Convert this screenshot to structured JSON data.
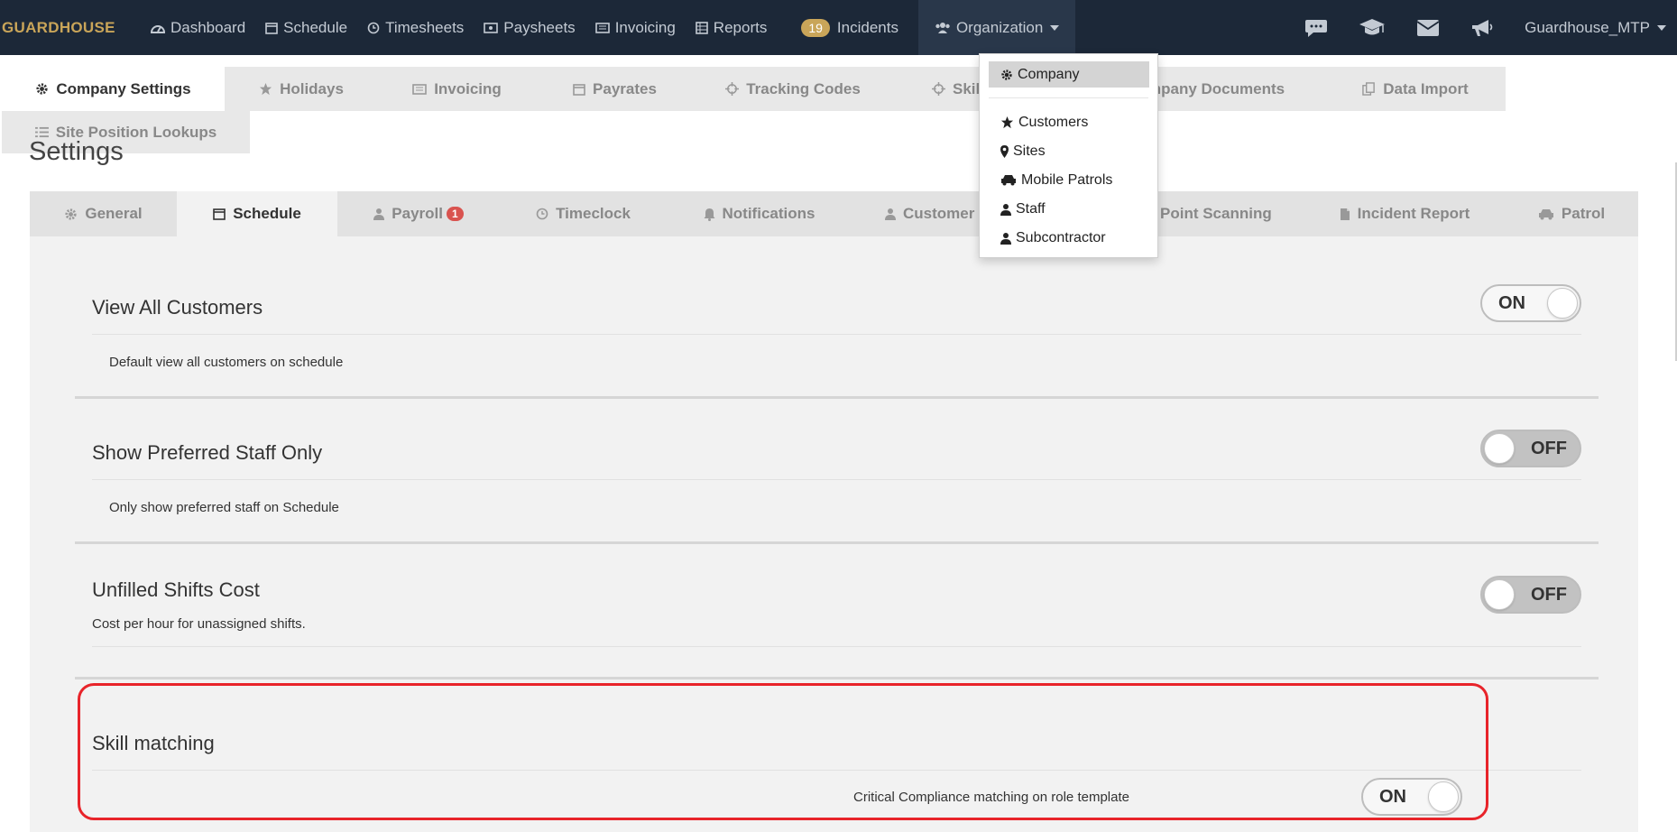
{
  "navbar": {
    "brand": "GUARDHOUSE",
    "items": [
      {
        "label": "Dashboard",
        "icon": "dashboard-icon"
      },
      {
        "label": "Schedule",
        "icon": "calendar-icon"
      },
      {
        "label": "Timesheets",
        "icon": "clock-icon"
      },
      {
        "label": "Paysheets",
        "icon": "money-icon"
      },
      {
        "label": "Invoicing",
        "icon": "invoice-icon"
      },
      {
        "label": "Reports",
        "icon": "table-icon"
      }
    ],
    "incidents": {
      "count": "19",
      "label": "Incidents"
    },
    "organization_label": "Organization",
    "user": "Guardhouse_MTP",
    "right_icons": [
      "chat-icon",
      "graduation-cap-icon",
      "envelope-icon",
      "bullhorn-icon"
    ]
  },
  "org_dropdown": {
    "items": [
      {
        "label": "Company",
        "icon": "gear-icon",
        "active": true
      },
      {
        "label": "Customers",
        "icon": "star-icon"
      },
      {
        "label": "Sites",
        "icon": "map-marker-icon"
      },
      {
        "label": "Mobile Patrols",
        "icon": "car-icon"
      },
      {
        "label": "Staff",
        "icon": "user-icon"
      },
      {
        "label": "Subcontractor",
        "icon": "user-icon"
      }
    ]
  },
  "company_tabs": [
    {
      "label": "Company Settings",
      "icon": "gear-icon",
      "active": true
    },
    {
      "label": "Holidays",
      "icon": "star-icon"
    },
    {
      "label": "Invoicing",
      "icon": "invoice-icon"
    },
    {
      "label": "Payrates",
      "icon": "calendar-icon"
    },
    {
      "label": "Tracking Codes",
      "icon": "crosshair-icon"
    },
    {
      "label": "Skil",
      "icon": "crosshair-icon"
    },
    {
      "label": "mpany Documents",
      "icon": ""
    },
    {
      "label": "Data Import",
      "icon": "copy-icon"
    },
    {
      "label": "Site Position Lookups",
      "icon": "list-icon"
    }
  ],
  "settings": {
    "title": "Settings",
    "tabs": [
      {
        "label": "General",
        "icon": "gear-icon"
      },
      {
        "label": "Schedule",
        "icon": "calendar-icon",
        "active": true
      },
      {
        "label": "Payroll",
        "icon": "user-icon",
        "badge": "1"
      },
      {
        "label": "Timeclock",
        "icon": "clock-icon"
      },
      {
        "label": "Notifications",
        "icon": "bell-icon"
      },
      {
        "label": "Customer I",
        "icon": "user-icon"
      },
      {
        "label": "Point Scanning",
        "icon": ""
      },
      {
        "label": "Incident Report",
        "icon": "file-icon"
      },
      {
        "label": "Patrol",
        "icon": "car-icon"
      }
    ],
    "items": [
      {
        "title": "View All Customers",
        "description": "Default view all customers on schedule",
        "state": "ON"
      },
      {
        "title": "Show Preferred Staff Only",
        "description": "Only show preferred staff on Schedule",
        "state": "OFF"
      },
      {
        "title": "Unfilled Shifts Cost",
        "description": "Cost per hour for unassigned shifts.",
        "state": "OFF"
      },
      {
        "title": "Skill matching",
        "description": "Critical Compliance matching on role template",
        "state": "ON"
      }
    ]
  },
  "colors": {
    "navbar": "#1c2838",
    "brand": "#c9a559",
    "highlight": "#e8242a",
    "panel": "#f2f2f2"
  }
}
